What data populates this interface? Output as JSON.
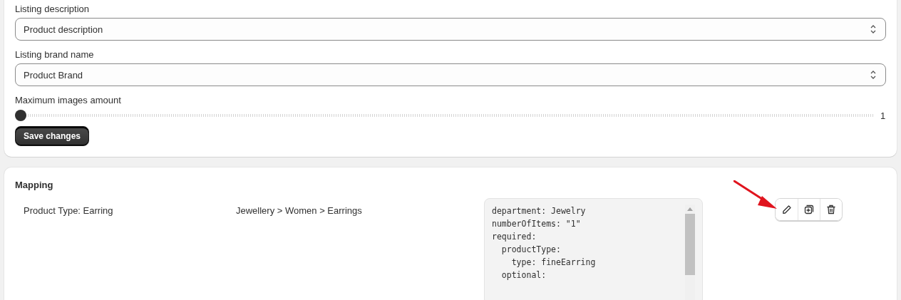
{
  "settings": {
    "fields": [
      {
        "label": "Listing description",
        "value": "Product description"
      },
      {
        "label": "Listing brand name",
        "value": "Product Brand"
      }
    ],
    "slider": {
      "label": "Maximum images amount",
      "level": 0,
      "reading": "1"
    },
    "save_button": "Save changes"
  },
  "mapping": {
    "title": "Mapping",
    "rows": [
      {
        "product_type": "Product Type: Earring",
        "category": "Jewellery > Women > Earrings",
        "code_lines": [
          "department: Jewelry",
          "numberOfItems: \"1\"",
          "required:",
          "  productType:",
          "    type: fineEarring",
          "  optional:"
        ]
      }
    ]
  }
}
